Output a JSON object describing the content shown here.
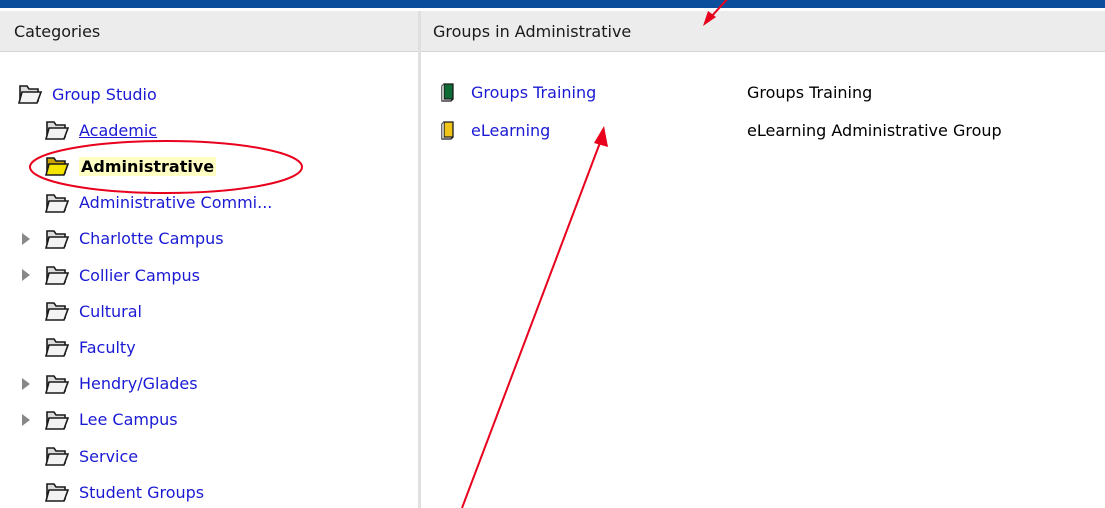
{
  "left_pane": {
    "title": "Categories"
  },
  "right_pane": {
    "title": "Groups in Administrative"
  },
  "tree": [
    {
      "label": "Group Studio",
      "icon": "folder-icon",
      "level": 0
    },
    {
      "label": "Academic",
      "icon": "folder-icon",
      "level": 1,
      "underlined": true
    },
    {
      "label": "Administrative",
      "icon": "open-folder-icon",
      "level": 1,
      "selected": true
    },
    {
      "label": "Administrative Commi...",
      "icon": "folder-icon",
      "level": 1
    },
    {
      "label": "Charlotte Campus",
      "icon": "folder-icon",
      "level": 1,
      "expandable": true
    },
    {
      "label": "Collier Campus",
      "icon": "folder-icon",
      "level": 1,
      "expandable": true
    },
    {
      "label": "Cultural",
      "icon": "folder-icon",
      "level": 1
    },
    {
      "label": "Faculty",
      "icon": "folder-icon",
      "level": 1
    },
    {
      "label": "Hendry/Glades",
      "icon": "folder-icon",
      "level": 1,
      "expandable": true
    },
    {
      "label": "Lee Campus",
      "icon": "folder-icon",
      "level": 1,
      "expandable": true
    },
    {
      "label": "Service",
      "icon": "folder-icon",
      "level": 1
    },
    {
      "label": "Student Groups",
      "icon": "folder-icon",
      "level": 1
    }
  ],
  "groups": [
    {
      "name": "Groups Training",
      "description": "Groups Training",
      "icon": "group-book-icon",
      "icon_color": "#0e6b35"
    },
    {
      "name": "eLearning",
      "description": "eLearning Administrative Group",
      "icon": "group-book-icon",
      "icon_color": "#f0c419"
    }
  ],
  "annotations": {
    "arrow_color": "#e8001c",
    "circle_color": "#e8001c",
    "selection_bg": "#ffffc4",
    "link_color": "#1a1ad4",
    "top_bar_color": "#0b4f9c"
  }
}
